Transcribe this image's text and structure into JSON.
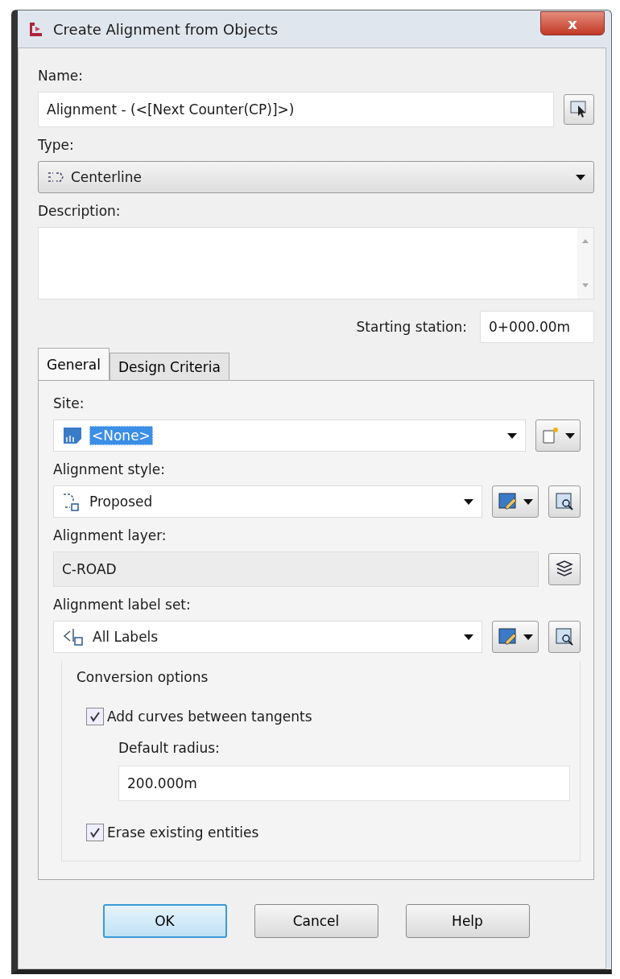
{
  "window": {
    "title": "Create Alignment from Objects",
    "close": "x"
  },
  "name": {
    "label": "Name:",
    "value": "Alignment - (<[Next Counter(CP)]>)"
  },
  "type": {
    "label": "Type:",
    "value": "Centerline"
  },
  "description": {
    "label": "Description:"
  },
  "starting_station": {
    "label": "Starting station:",
    "value": "0+000.00m"
  },
  "tabs": [
    {
      "label": "General",
      "selected": true
    },
    {
      "label": "Design Criteria",
      "selected": false
    }
  ],
  "site": {
    "label": "Site:",
    "value": "<None>",
    "selected": true
  },
  "alignment_style": {
    "label": "Alignment style:",
    "value": "Proposed"
  },
  "alignment_layer": {
    "label": "Alignment layer:",
    "value": "C-ROAD"
  },
  "alignment_label_set": {
    "label": "Alignment label set:",
    "value": "All Labels"
  },
  "conversion_options": {
    "title": "Conversion options",
    "add_curves": {
      "label": "Add curves between tangents",
      "checked": true
    },
    "default_radius": {
      "label": "Default radius:",
      "value": "200.000m"
    },
    "erase_existing": {
      "label": "Erase existing entities",
      "checked": true
    }
  },
  "buttons": [
    {
      "label": "OK",
      "default": true
    },
    {
      "label": "Cancel",
      "default": false
    },
    {
      "label": "Help",
      "default": false
    }
  ]
}
